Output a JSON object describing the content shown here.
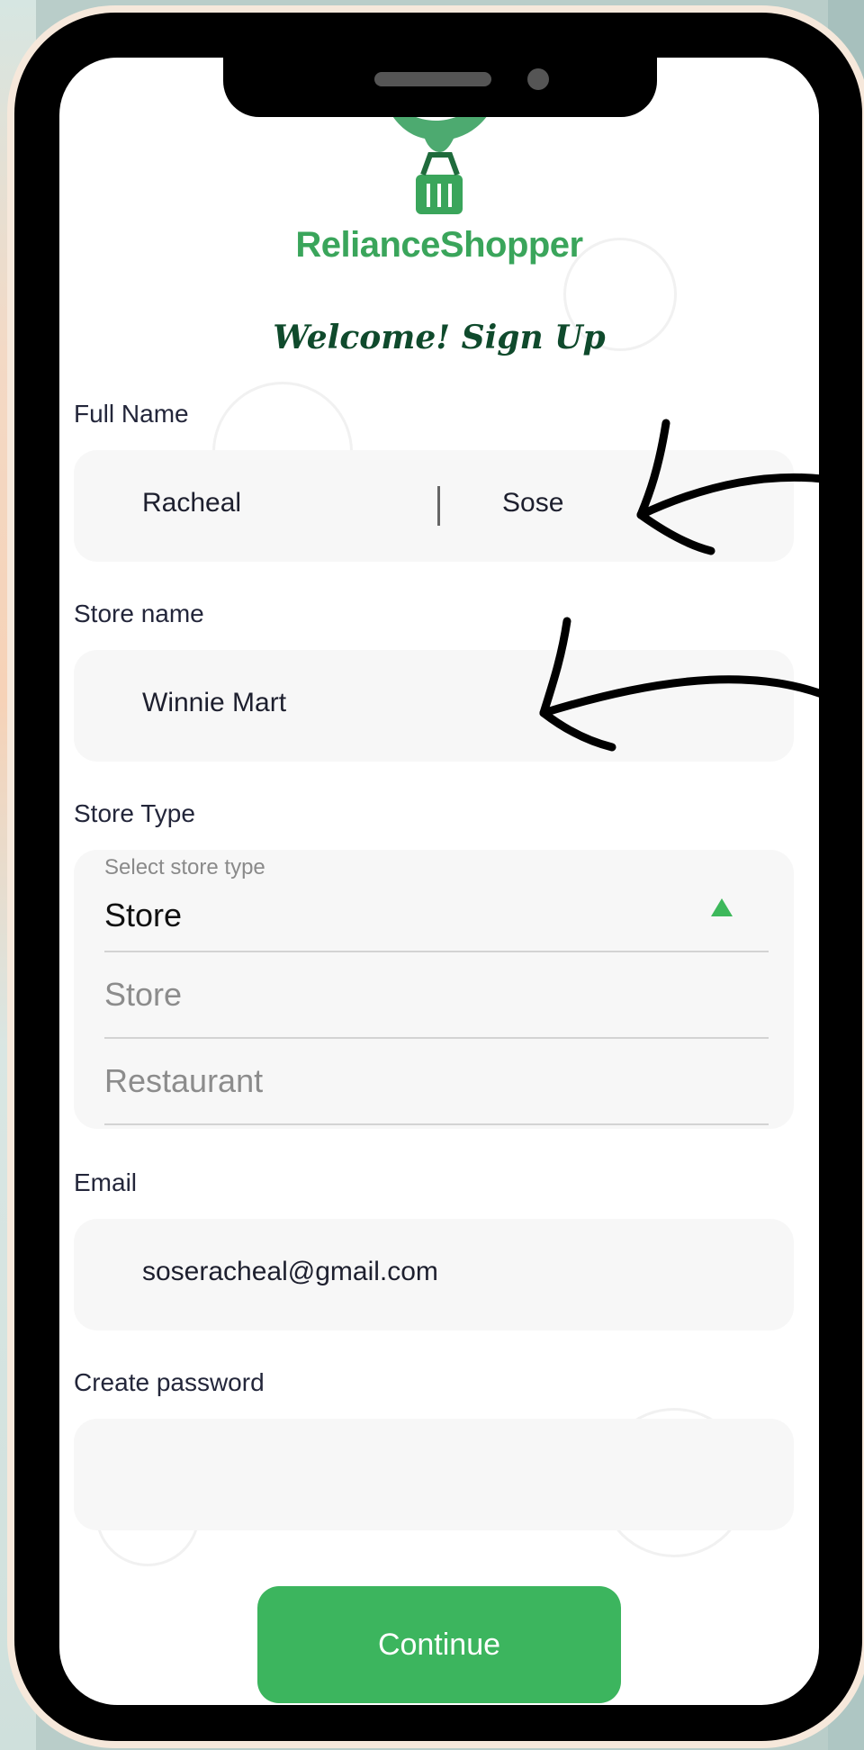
{
  "app": {
    "brand_name": "RelianceShopper",
    "welcome_title": "Welcome! Sign Up",
    "brand_color": "#3aa55b",
    "accent_color": "#3cb55e"
  },
  "form": {
    "full_name": {
      "label": "Full Name",
      "first_value": "Racheal",
      "last_value": "Sose"
    },
    "store_name": {
      "label": "Store name",
      "value": "Winnie Mart"
    },
    "store_type": {
      "label": "Store Type",
      "hint": "Select store type",
      "selected": "Store",
      "options": [
        "Store",
        "Restaurant"
      ]
    },
    "email": {
      "label": "Email",
      "value": "soseracheal@gmail.com"
    },
    "password": {
      "label": "Create password",
      "value": ""
    },
    "continue_label": "Continue"
  },
  "icons": {
    "logo": "eagle-basket-logo",
    "dropdown": "caret-up-icon",
    "annotation": "hand-drawn-arrow-icon"
  }
}
